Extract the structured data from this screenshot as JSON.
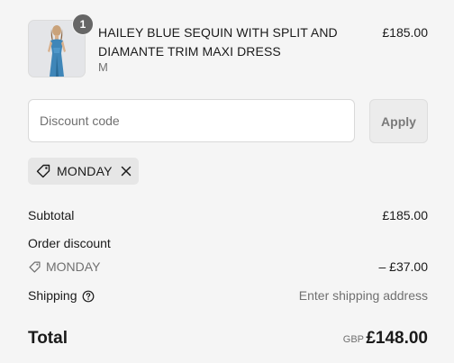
{
  "cart": {
    "item": {
      "quantity": "1",
      "name": "HAILEY BLUE SEQUIN WITH SPLIT AND DIAMANTE TRIM MAXI DRESS",
      "variant": "M",
      "price": "£185.00"
    }
  },
  "discount": {
    "placeholder": "Discount code",
    "apply_label": "Apply",
    "applied_code": "MONDAY"
  },
  "summary": {
    "subtotal_label": "Subtotal",
    "subtotal_value": "£185.00",
    "order_discount_label": "Order discount",
    "discount_code": "MONDAY",
    "discount_value": "– £37.00",
    "shipping_label": "Shipping",
    "shipping_value": "Enter shipping address",
    "total_label": "Total",
    "currency": "GBP",
    "total_value": "£148.00"
  },
  "icons": {
    "tag": "tag-icon",
    "remove": "close-icon",
    "help": "question-circle-icon"
  },
  "colors": {
    "background": "#f5f5f5",
    "badge": "#666666",
    "chip": "#e6e6e6",
    "muted_text": "#707070",
    "dress": "#3f86b8"
  }
}
